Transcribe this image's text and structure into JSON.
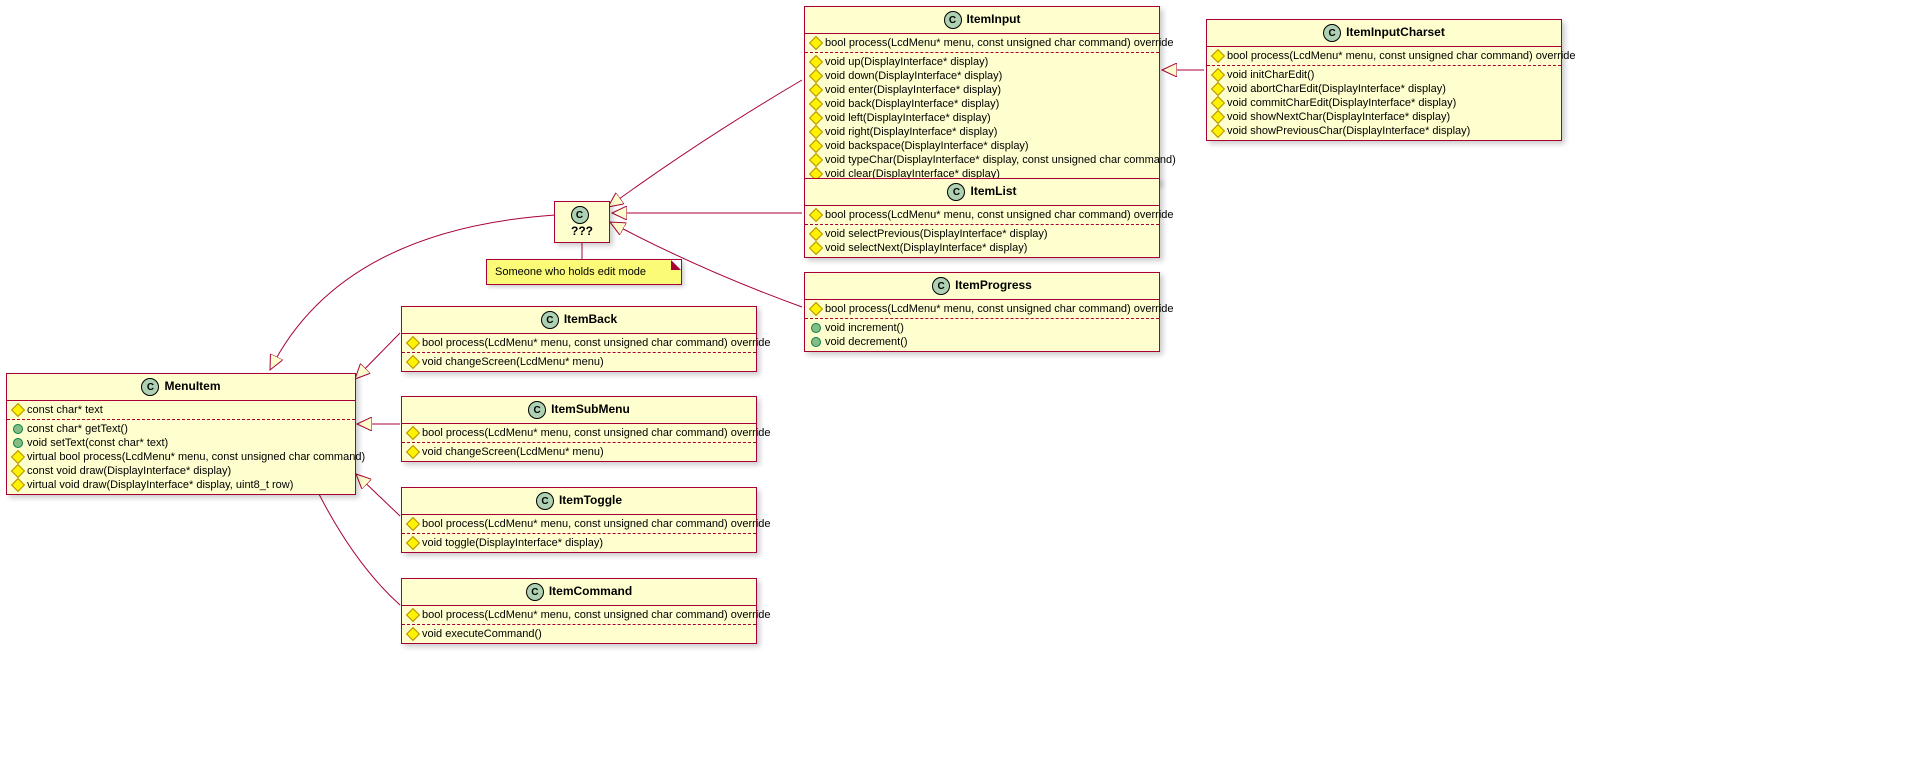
{
  "classes": {
    "menuItem": {
      "name": "MenuItem",
      "fields": [
        "const char* text"
      ],
      "fieldVis": [
        "protected"
      ],
      "methods": [
        "const char* getText()",
        "void setText(const char* text)",
        "virtual bool process(LcdMenu* menu, const unsigned char command)",
        "const void draw(DisplayInterface* display)",
        "virtual void draw(DisplayInterface* display, uint8_t row)"
      ],
      "methodVis": [
        "public",
        "public",
        "protected",
        "protected",
        "protected"
      ]
    },
    "unknown": {
      "name": "???",
      "note": "Someone who holds edit mode"
    },
    "itemInput": {
      "name": "ItemInput",
      "sec1": [
        "bool process(LcdMenu* menu, const unsigned char command) override"
      ],
      "sec1Vis": [
        "protected"
      ],
      "sec2": [
        "void up(DisplayInterface* display)",
        "void down(DisplayInterface* display)",
        "void enter(DisplayInterface* display)",
        "void back(DisplayInterface* display)",
        "void left(DisplayInterface* display)",
        "void right(DisplayInterface* display)",
        "void backspace(DisplayInterface* display)",
        "void typeChar(DisplayInterface* display, const unsigned char command)",
        "void clear(DisplayInterface* display)"
      ],
      "sec2Vis": [
        "protected",
        "protected",
        "protected",
        "protected",
        "protected",
        "protected",
        "protected",
        "protected",
        "protected"
      ]
    },
    "itemInputCharset": {
      "name": "ItemInputCharset",
      "sec1": [
        "bool process(LcdMenu* menu, const unsigned char command) override"
      ],
      "sec1Vis": [
        "protected"
      ],
      "sec2": [
        "void initCharEdit()",
        "void abortCharEdit(DisplayInterface* display)",
        "void commitCharEdit(DisplayInterface* display)",
        "void showNextChar(DisplayInterface* display)",
        "void showPreviousChar(DisplayInterface* display)"
      ],
      "sec2Vis": [
        "protected",
        "protected",
        "protected",
        "protected",
        "protected"
      ]
    },
    "itemList": {
      "name": "ItemList",
      "sec1": [
        "bool process(LcdMenu* menu, const unsigned char command) override"
      ],
      "sec1Vis": [
        "protected"
      ],
      "sec2": [
        "void selectPrevious(DisplayInterface* display)",
        "void selectNext(DisplayInterface* display)"
      ],
      "sec2Vis": [
        "protected",
        "protected"
      ]
    },
    "itemProgress": {
      "name": "ItemProgress",
      "sec1": [
        "bool process(LcdMenu* menu, const unsigned char command) override"
      ],
      "sec1Vis": [
        "protected"
      ],
      "sec2": [
        "void increment()",
        "void decrement()"
      ],
      "sec2Vis": [
        "public",
        "public"
      ]
    },
    "itemBack": {
      "name": "ItemBack",
      "sec1": [
        "bool process(LcdMenu* menu, const unsigned char command) override"
      ],
      "sec1Vis": [
        "protected"
      ],
      "sec2": [
        "void changeScreen(LcdMenu* menu)"
      ],
      "sec2Vis": [
        "protected"
      ]
    },
    "itemSubMenu": {
      "name": "ItemSubMenu",
      "sec1": [
        "bool process(LcdMenu* menu, const unsigned char command) override"
      ],
      "sec1Vis": [
        "protected"
      ],
      "sec2": [
        "void changeScreen(LcdMenu* menu)"
      ],
      "sec2Vis": [
        "protected"
      ]
    },
    "itemToggle": {
      "name": "ItemToggle",
      "sec1": [
        "bool process(LcdMenu* menu, const unsigned char command) override"
      ],
      "sec1Vis": [
        "protected"
      ],
      "sec2": [
        "void toggle(DisplayInterface* display)"
      ],
      "sec2Vis": [
        "protected"
      ]
    },
    "itemCommand": {
      "name": "ItemCommand",
      "sec1": [
        "bool process(LcdMenu* menu, const unsigned char command) override"
      ],
      "sec1Vis": [
        "protected"
      ],
      "sec2": [
        "void executeCommand()"
      ],
      "sec2Vis": [
        "protected"
      ]
    }
  }
}
